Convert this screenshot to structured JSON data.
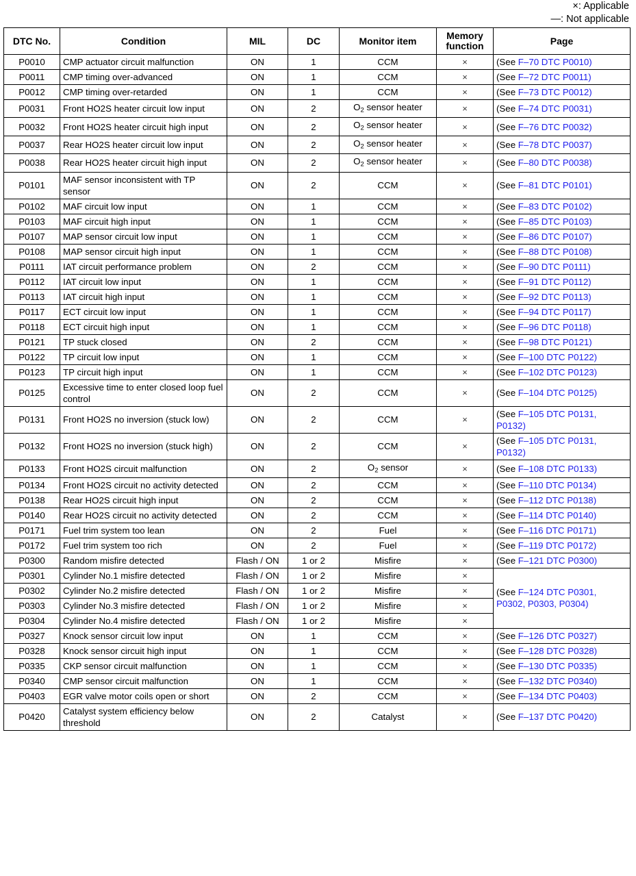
{
  "legend": {
    "applicable": "×: Applicable",
    "not_applicable": "—: Not applicable"
  },
  "table": {
    "headers": {
      "dtc_no": "DTC No.",
      "condition": "Condition",
      "mil": "MIL",
      "dc": "DC",
      "monitor_item": "Monitor item",
      "memory_function_line1": "Memory",
      "memory_function_line2": "function",
      "page": "Page"
    },
    "page_prefix": "(See ",
    "page_suffix": ")",
    "colors": {
      "link": "#2020ee",
      "text": "#000000",
      "border": "#000000"
    },
    "rows": [
      {
        "dtc": "P0010",
        "condition": "CMP actuator circuit malfunction",
        "mil": "ON",
        "dc": "1",
        "monitor": "CCM",
        "memory": "×",
        "page_link": "F–70 DTC P0010"
      },
      {
        "dtc": "P0011",
        "condition": "CMP timing over-advanced",
        "mil": "ON",
        "dc": "1",
        "monitor": "CCM",
        "memory": "×",
        "page_link": "F–72 DTC P0011"
      },
      {
        "dtc": "P0012",
        "condition": "CMP timing over-retarded",
        "mil": "ON",
        "dc": "1",
        "monitor": "CCM",
        "memory": "×",
        "page_link": "F–73 DTC P0012"
      },
      {
        "dtc": "P0031",
        "condition": "Front HO2S heater circuit low input",
        "mil": "ON",
        "dc": "2",
        "monitor": "O2 sensor heater",
        "monitor_sub": true,
        "memory": "×",
        "page_link": "F–74 DTC P0031"
      },
      {
        "dtc": "P0032",
        "condition": "Front HO2S heater circuit high input",
        "mil": "ON",
        "dc": "2",
        "monitor": "O2 sensor heater",
        "monitor_sub": true,
        "memory": "×",
        "page_link": "F–76 DTC P0032"
      },
      {
        "dtc": "P0037",
        "condition": "Rear HO2S heater circuit low input",
        "mil": "ON",
        "dc": "2",
        "monitor": "O2 sensor heater",
        "monitor_sub": true,
        "memory": "×",
        "page_link": "F–78 DTC P0037"
      },
      {
        "dtc": "P0038",
        "condition": "Rear HO2S heater circuit high input",
        "mil": "ON",
        "dc": "2",
        "monitor": "O2 sensor heater",
        "monitor_sub": true,
        "memory": "×",
        "page_link": "F–80 DTC P0038"
      },
      {
        "dtc": "P0101",
        "condition": "MAF sensor inconsistent with TP sensor",
        "mil": "ON",
        "dc": "2",
        "monitor": "CCM",
        "memory": "×",
        "page_link": "F–81 DTC P0101"
      },
      {
        "dtc": "P0102",
        "condition": "MAF circuit low input",
        "mil": "ON",
        "dc": "1",
        "monitor": "CCM",
        "memory": "×",
        "page_link": "F–83 DTC P0102"
      },
      {
        "dtc": "P0103",
        "condition": "MAF circuit high input",
        "mil": "ON",
        "dc": "1",
        "monitor": "CCM",
        "memory": "×",
        "page_link": "F–85 DTC P0103"
      },
      {
        "dtc": "P0107",
        "condition": "MAP sensor circuit low input",
        "mil": "ON",
        "dc": "1",
        "monitor": "CCM",
        "memory": "×",
        "page_link": "F–86 DTC P0107"
      },
      {
        "dtc": "P0108",
        "condition": "MAP sensor circuit high input",
        "mil": "ON",
        "dc": "1",
        "monitor": "CCM",
        "memory": "×",
        "page_link": "F–88 DTC P0108"
      },
      {
        "dtc": "P0111",
        "condition": "IAT circuit performance problem",
        "mil": "ON",
        "dc": "2",
        "monitor": "CCM",
        "memory": "×",
        "page_link": "F–90 DTC P0111"
      },
      {
        "dtc": "P0112",
        "condition": "IAT circuit low input",
        "mil": "ON",
        "dc": "1",
        "monitor": "CCM",
        "memory": "×",
        "page_link": "F–91 DTC P0112"
      },
      {
        "dtc": "P0113",
        "condition": "IAT circuit high input",
        "mil": "ON",
        "dc": "1",
        "monitor": "CCM",
        "memory": "×",
        "page_link": "F–92 DTC P0113"
      },
      {
        "dtc": "P0117",
        "condition": "ECT circuit low input",
        "mil": "ON",
        "dc": "1",
        "monitor": "CCM",
        "memory": "×",
        "page_link": "F–94 DTC P0117"
      },
      {
        "dtc": "P0118",
        "condition": "ECT circuit high input",
        "mil": "ON",
        "dc": "1",
        "monitor": "CCM",
        "memory": "×",
        "page_link": "F–96 DTC P0118"
      },
      {
        "dtc": "P0121",
        "condition": "TP stuck closed",
        "mil": "ON",
        "dc": "2",
        "monitor": "CCM",
        "memory": "×",
        "page_link": "F–98 DTC P0121"
      },
      {
        "dtc": "P0122",
        "condition": "TP circuit low input",
        "mil": "ON",
        "dc": "1",
        "monitor": "CCM",
        "memory": "×",
        "page_link": "F–100 DTC P0122"
      },
      {
        "dtc": "P0123",
        "condition": "TP circuit high input",
        "mil": "ON",
        "dc": "1",
        "monitor": "CCM",
        "memory": "×",
        "page_link": "F–102 DTC P0123"
      },
      {
        "dtc": "P0125",
        "condition": "Excessive time to enter closed loop fuel control",
        "mil": "ON",
        "dc": "2",
        "monitor": "CCM",
        "memory": "×",
        "page_link": "F–104 DTC P0125"
      },
      {
        "dtc": "P0131",
        "condition": "Front HO2S no inversion (stuck low)",
        "mil": "ON",
        "dc": "2",
        "monitor": "CCM",
        "memory": "×",
        "page_link": "F–105 DTC P0131, P0132"
      },
      {
        "dtc": "P0132",
        "condition": "Front HO2S no inversion (stuck high)",
        "mil": "ON",
        "dc": "2",
        "monitor": "CCM",
        "memory": "×",
        "page_link": "F–105 DTC P0131, P0132"
      },
      {
        "dtc": "P0133",
        "condition": "Front HO2S circuit malfunction",
        "mil": "ON",
        "dc": "2",
        "monitor": "O2 sensor",
        "monitor_sub": true,
        "memory": "×",
        "page_link": "F–108 DTC P0133"
      },
      {
        "dtc": "P0134",
        "condition": "Front HO2S circuit no activity detected",
        "mil": "ON",
        "dc": "2",
        "monitor": "CCM",
        "memory": "×",
        "page_link": "F–110 DTC P0134"
      },
      {
        "dtc": "P0138",
        "condition": "Rear HO2S circuit high input",
        "mil": "ON",
        "dc": "2",
        "monitor": "CCM",
        "memory": "×",
        "page_link": "F–112 DTC P0138"
      },
      {
        "dtc": "P0140",
        "condition": "Rear HO2S circuit no activity detected",
        "mil": "ON",
        "dc": "2",
        "monitor": "CCM",
        "memory": "×",
        "page_link": "F–114 DTC P0140"
      },
      {
        "dtc": "P0171",
        "condition": "Fuel trim system too lean",
        "mil": "ON",
        "dc": "2",
        "monitor": "Fuel",
        "memory": "×",
        "page_link": "F–116 DTC P0171"
      },
      {
        "dtc": "P0172",
        "condition": "Fuel trim system too rich",
        "mil": "ON",
        "dc": "2",
        "monitor": "Fuel",
        "memory": "×",
        "page_link": "F–119 DTC P0172"
      },
      {
        "dtc": "P0300",
        "condition": "Random misfire detected",
        "mil": "Flash / ON",
        "dc": "1 or 2",
        "monitor": "Misfire",
        "memory": "×",
        "page_link": "F–121 DTC P0300"
      },
      {
        "dtc": "P0301",
        "condition": "Cylinder No.1 misfire detected",
        "mil": "Flash / ON",
        "dc": "1 or 2",
        "monitor": "Misfire",
        "memory": "×",
        "page_link": "F–124 DTC P0301, P0302, P0303, P0304",
        "page_rowspan": 4
      },
      {
        "dtc": "P0302",
        "condition": "Cylinder No.2 misfire detected",
        "mil": "Flash / ON",
        "dc": "1 or 2",
        "monitor": "Misfire",
        "memory": "×",
        "page_skip": true
      },
      {
        "dtc": "P0303",
        "condition": "Cylinder No.3 misfire detected",
        "mil": "Flash / ON",
        "dc": "1 or 2",
        "monitor": "Misfire",
        "memory": "×",
        "page_skip": true
      },
      {
        "dtc": "P0304",
        "condition": "Cylinder No.4 misfire detected",
        "mil": "Flash / ON",
        "dc": "1 or 2",
        "monitor": "Misfire",
        "memory": "×",
        "page_skip": true
      },
      {
        "dtc": "P0327",
        "condition": "Knock sensor circuit low input",
        "mil": "ON",
        "dc": "1",
        "monitor": "CCM",
        "memory": "×",
        "page_link": "F–126 DTC P0327"
      },
      {
        "dtc": "P0328",
        "condition": "Knock sensor circuit high input",
        "mil": "ON",
        "dc": "1",
        "monitor": "CCM",
        "memory": "×",
        "page_link": "F–128 DTC P0328"
      },
      {
        "dtc": "P0335",
        "condition": "CKP sensor circuit malfunction",
        "mil": "ON",
        "dc": "1",
        "monitor": "CCM",
        "memory": "×",
        "page_link": "F–130 DTC P0335"
      },
      {
        "dtc": "P0340",
        "condition": "CMP sensor circuit malfunction",
        "mil": "ON",
        "dc": "1",
        "monitor": "CCM",
        "memory": "×",
        "page_link": "F–132 DTC P0340"
      },
      {
        "dtc": "P0403",
        "condition": "EGR valve motor coils open or short",
        "mil": "ON",
        "dc": "2",
        "monitor": "CCM",
        "memory": "×",
        "page_link": "F–134 DTC P0403"
      },
      {
        "dtc": "P0420",
        "condition": "Catalyst system efficiency below threshold",
        "mil": "ON",
        "dc": "2",
        "monitor": "Catalyst",
        "memory": "×",
        "page_link": "F–137 DTC P0420"
      }
    ]
  }
}
